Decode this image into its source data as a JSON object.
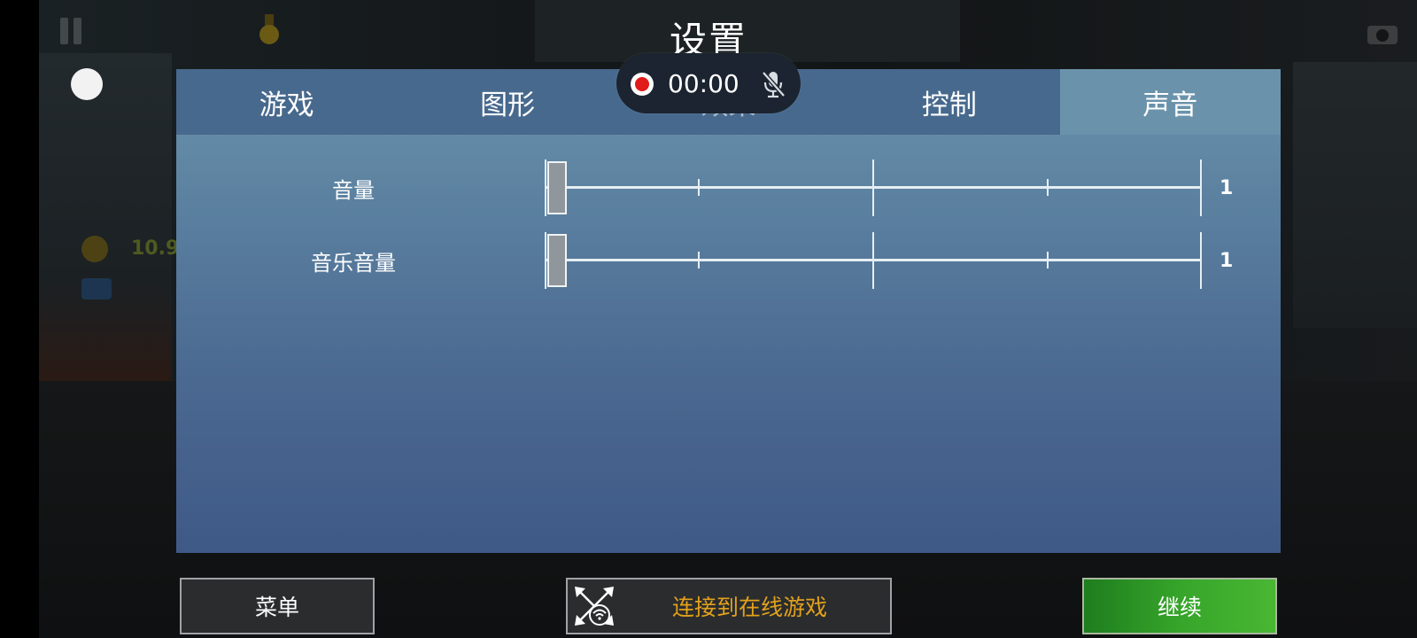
{
  "title": "设置",
  "tabs": [
    {
      "label": "游戏",
      "active": false
    },
    {
      "label": "图形",
      "active": false
    },
    {
      "label": "效果",
      "active": false
    },
    {
      "label": "控制",
      "active": false
    },
    {
      "label": "声音",
      "active": true
    }
  ],
  "sound": {
    "rows": [
      {
        "label": "音量",
        "value": "1",
        "slider_fraction": 0.0
      },
      {
        "label": "音乐音量",
        "value": "1",
        "slider_fraction": 0.0
      }
    ]
  },
  "recorder": {
    "time": "00:00",
    "dot_color": "#e11a1a",
    "mic_icon": "mic-off-icon"
  },
  "hud": {
    "coin_value": "10.9",
    "icons": [
      "pause-icon",
      "medal-icon",
      "camera-icon",
      "coin-icon",
      "cash-icon"
    ]
  },
  "buttons": {
    "menu": "菜单",
    "online": "连接到在线游戏",
    "continue": "继续"
  },
  "colors": {
    "tab_inactive": "#47698d",
    "tab_active": "#6a93ab",
    "online_text": "#e3a11a",
    "continue_green": "#36a52a"
  }
}
